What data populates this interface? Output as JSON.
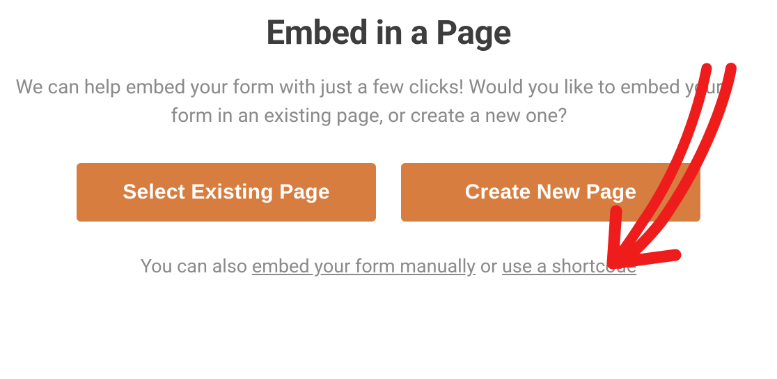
{
  "dialog": {
    "title": "Embed in a Page",
    "description": "We can help embed your form with just a few clicks! Would you like to embed your form in an existing page, or create a new one?",
    "buttons": {
      "select_existing": "Select Existing Page",
      "create_new": "Create New Page"
    },
    "footer": {
      "prefix": "You can also ",
      "link_manual": "embed your form manually",
      "middle": " or ",
      "link_shortcode": "use a shortcode"
    }
  },
  "annotation": {
    "type": "hand-drawn-arrow",
    "color": "#ef1c1c",
    "points_to": "create-new-page-button"
  }
}
